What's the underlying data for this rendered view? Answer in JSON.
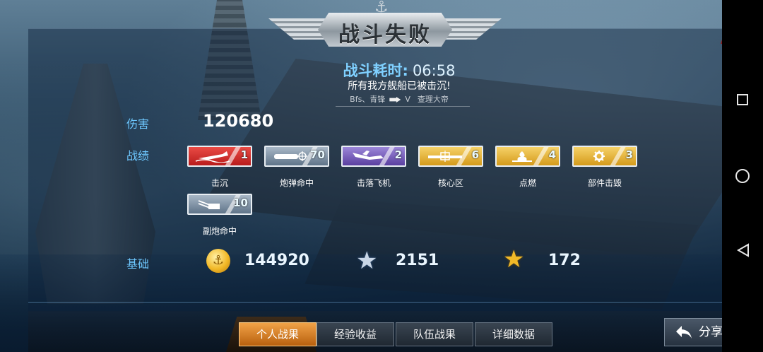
{
  "header": {
    "title": "战斗失败"
  },
  "close_label": "×",
  "battle": {
    "duration_label": "战斗耗时:",
    "duration_value": "06:58",
    "message": "所有我方舰船已被击沉!",
    "sunk_by_left": "Bfs、青锋",
    "sunk_by_mid": "V",
    "sunk_by_right": "查理大帝"
  },
  "damage": {
    "label": "伤害",
    "value": "120680"
  },
  "record": {
    "label": "战绩",
    "medals": [
      {
        "name": "击沉",
        "count": "1",
        "color": "#d7312f",
        "icon": "ship-sinking-icon"
      },
      {
        "name": "炮弹命中",
        "count": "70",
        "color": "#7c8ea1",
        "icon": "shell-hit-icon"
      },
      {
        "name": "击落飞机",
        "count": "2",
        "color": "#6f55bf",
        "icon": "plane-down-icon"
      },
      {
        "name": "核心区",
        "count": "6",
        "color": "#e4b13a",
        "icon": "citadel-icon"
      },
      {
        "name": "点燃",
        "count": "4",
        "color": "#e4b13a",
        "icon": "fire-icon"
      },
      {
        "name": "部件击毁",
        "count": "3",
        "color": "#e4b13a",
        "icon": "gear-icon"
      },
      {
        "name": "副炮命中",
        "count": "10",
        "color": "#7c8ea1",
        "icon": "secondary-gun-icon"
      }
    ]
  },
  "base": {
    "label": "基础",
    "coins": "144920",
    "silver_star": "2151",
    "gold_star": "172"
  },
  "tabs": [
    {
      "label": "个人战果",
      "active": true
    },
    {
      "label": "经验收益",
      "active": false
    },
    {
      "label": "队伍战果",
      "active": false
    },
    {
      "label": "详细数据",
      "active": false
    }
  ],
  "share": {
    "label": "分享"
  }
}
